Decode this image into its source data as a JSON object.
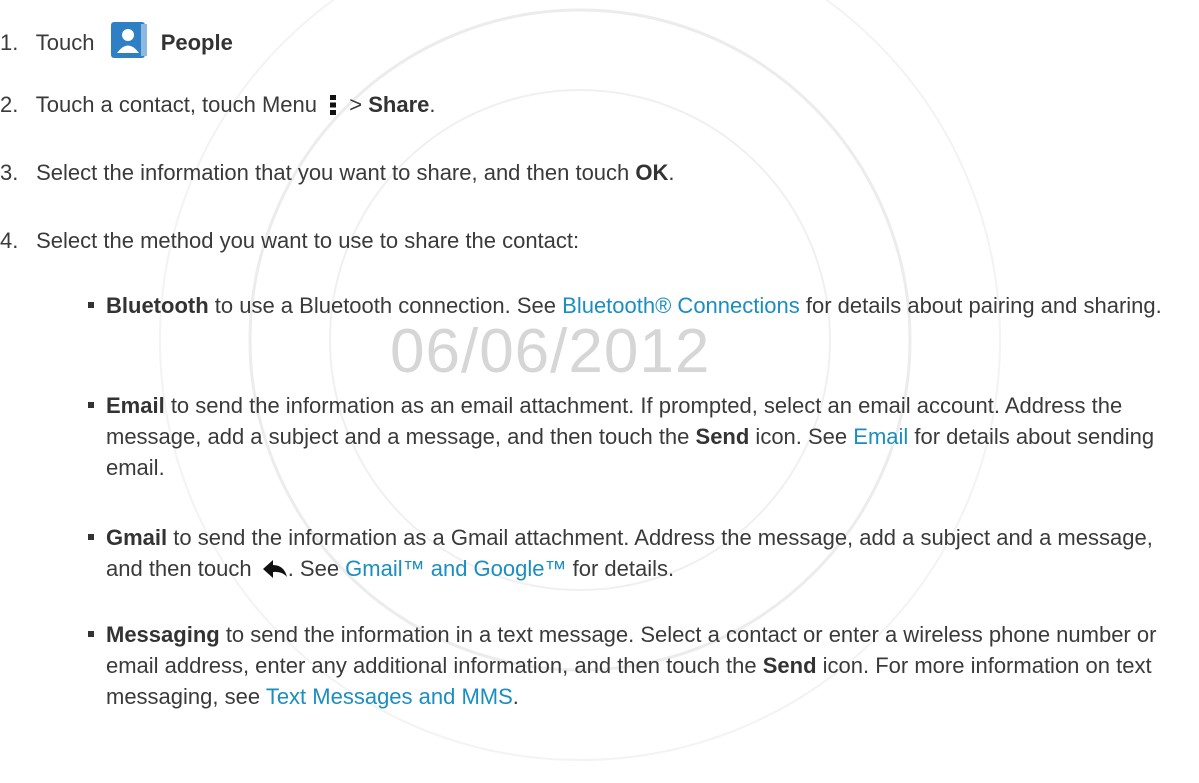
{
  "watermark": {
    "date": "06/06/2012"
  },
  "steps": [
    {
      "num": "1.",
      "pre": "Touch",
      "bold": "People"
    },
    {
      "num": "2.",
      "pre": "Touch a contact, touch Menu",
      "mid": ">",
      "bold": "Share",
      "post": "."
    },
    {
      "num": "3.",
      "pre": "Select the information that you want to share, and then touch",
      "bold": "OK",
      "post": "."
    },
    {
      "num": "4.",
      "pre": "Select the method you want to use to share the contact:"
    }
  ],
  "bullets": {
    "bluetooth": {
      "title": "Bluetooth",
      "t1": " to use a Bluetooth connection. See ",
      "link": "Bluetooth® Connections",
      "t2": " for details about pairing and sharing."
    },
    "email": {
      "title": "Email",
      "t1": " to send the information as an email attachment. If prompted, select an email account. Address the message, add a subject and a message, and then touch the ",
      "send": "Send",
      "t2": " icon. See ",
      "link": "Email",
      "t3": " for details about sending email."
    },
    "gmail": {
      "title": "Gmail",
      "t1": " to send the information as a Gmail attachment. Address the message, add a subject and a message, and then touch ",
      "t2": ". See ",
      "link": "Gmail™ and Google™",
      "t3": " for details."
    },
    "messaging": {
      "title": "Messaging",
      "t1": " to send the information in a text message. Select a contact or enter a wireless phone number or email address, enter any additional information, and then touch the ",
      "send": "Send",
      "t2": " icon. For more information on text messaging, see ",
      "link": "Text Messages and MMS",
      "t3": "."
    }
  },
  "icons": {
    "people": "people-app-icon",
    "menu": "menu-icon",
    "reply": "reply-arrow-icon"
  },
  "colors": {
    "link": "#1a8ec0",
    "text": "#3a3a3a",
    "watermark": "#d6d6d6",
    "people_icon": "#2f7fc4"
  }
}
